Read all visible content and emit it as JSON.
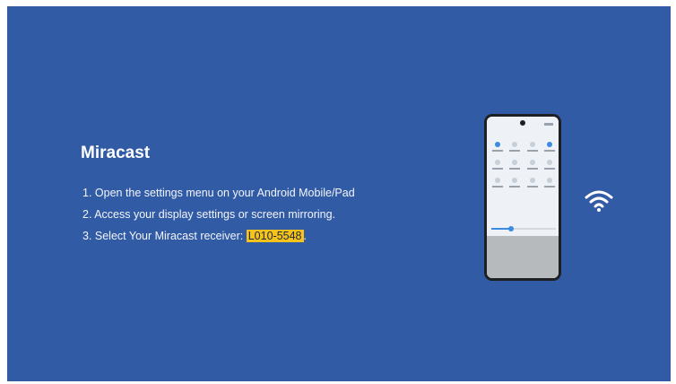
{
  "miracast": {
    "title": "Miracast",
    "steps": [
      "1. Open the settings menu on your Android Mobile/Pad",
      "2. Access your display settings or screen mirroring.",
      "3. Select Your Miracast receiver: "
    ],
    "receiver_name": "L010-5548",
    "receiver_suffix": "."
  },
  "colors": {
    "background": "#325ba6",
    "highlight": "#f6c21b",
    "text": "#ffffff"
  },
  "icons": {
    "phone": "phone-illustration",
    "wifi": "wifi-icon"
  },
  "phone": {
    "brightness_level": 0.3
  }
}
